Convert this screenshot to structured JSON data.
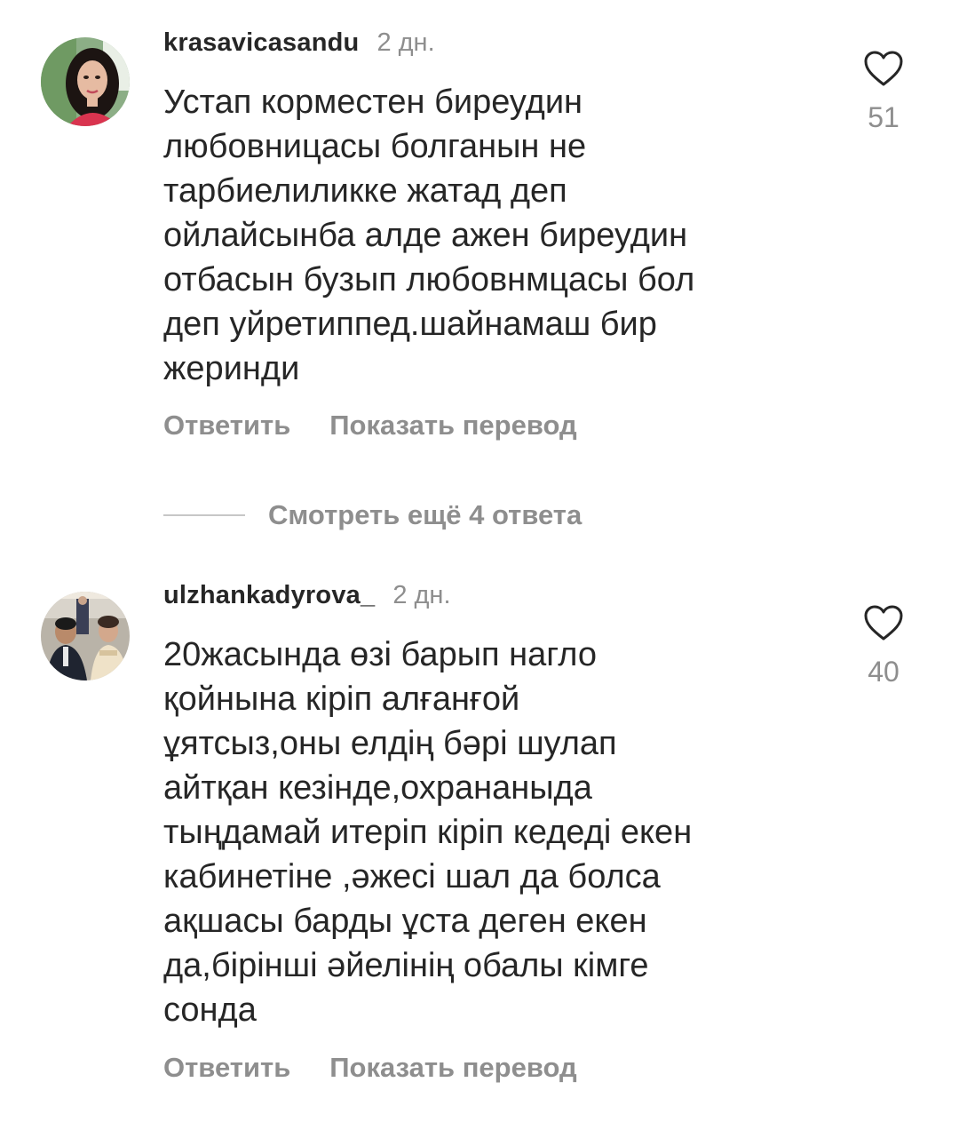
{
  "comments": [
    {
      "username": "krasavicasandu",
      "time": "2 дн.",
      "text_lines": [
        "Устап корместен биреудин",
        "любовницасы болганын не",
        "тарбиелиликке жатад деп",
        "ойлайсынба алде ажен биреудин",
        "отбасын бузып любовнмцасы бол",
        "деп уйретиппед.шайнамаш бир",
        "жеринди"
      ],
      "likes": "51",
      "reply_label": "Ответить",
      "translate_label": "Показать перевод",
      "avatar_icon": "profile-photo-woman",
      "like_icon": "heart-outline-icon"
    },
    {
      "username": "ulzhankadyrova_",
      "time": "2 дн.",
      "text_lines": [
        "20жасында өзі барып нагло",
        "қойнына кіріп алғанғой",
        "ұятсыз,оны елдің бәрі шулап",
        "айтқан кезінде,охрананыда",
        "тыңдамай итеріп кіріп кедеді екен",
        "кабинетіне ,әжесі шал да болса",
        "ақшасы барды ұста деген екен",
        "да,бірінші әйелінің обалы кімге",
        "сонда"
      ],
      "likes": "40",
      "reply_label": "Ответить",
      "translate_label": "Показать перевод",
      "avatar_icon": "profile-photo-group",
      "like_icon": "heart-outline-icon"
    }
  ],
  "view_replies": {
    "label": "Смотреть ещё 4 ответа"
  },
  "colors": {
    "text_primary": "#262626",
    "text_secondary": "#8e8e8e",
    "divider": "#c7c7c7",
    "background": "#ffffff"
  }
}
